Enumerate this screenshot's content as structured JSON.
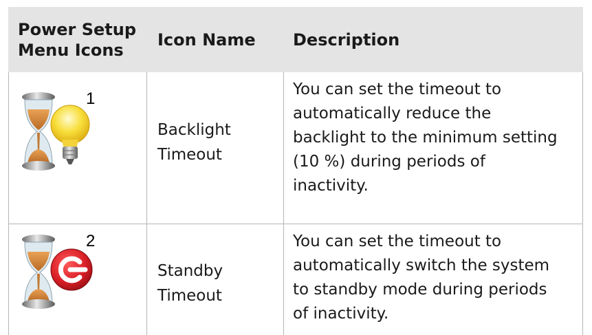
{
  "header": {
    "col1": "Power Setup Menu Icons",
    "col1_line1": "Power Setup",
    "col1_line2": "Menu Icons",
    "col2": "Icon Name",
    "col3": "Description"
  },
  "rows": [
    {
      "icon": "hourglass-lightbulb-icon",
      "badge": "1",
      "name_line1": "Backlight",
      "name_line2": "Timeout",
      "desc_lines": [
        "You can set the timeout to",
        "automatically reduce the",
        "backlight to the minimum setting",
        "(10 %) during periods of",
        "inactivity."
      ]
    },
    {
      "icon": "hourglass-standby-icon",
      "badge": "2",
      "name_line1": "Standby",
      "name_line2": "Timeout",
      "desc_lines": [
        "You can set the timeout to",
        "automatically switch the system",
        "to standby mode during periods",
        "of inactivity."
      ]
    }
  ],
  "colors": {
    "header_bg": "#e4e4e4",
    "grid": "#b5b5b5",
    "bulb": "#f6d21a",
    "standby_red": "#d81e26"
  }
}
